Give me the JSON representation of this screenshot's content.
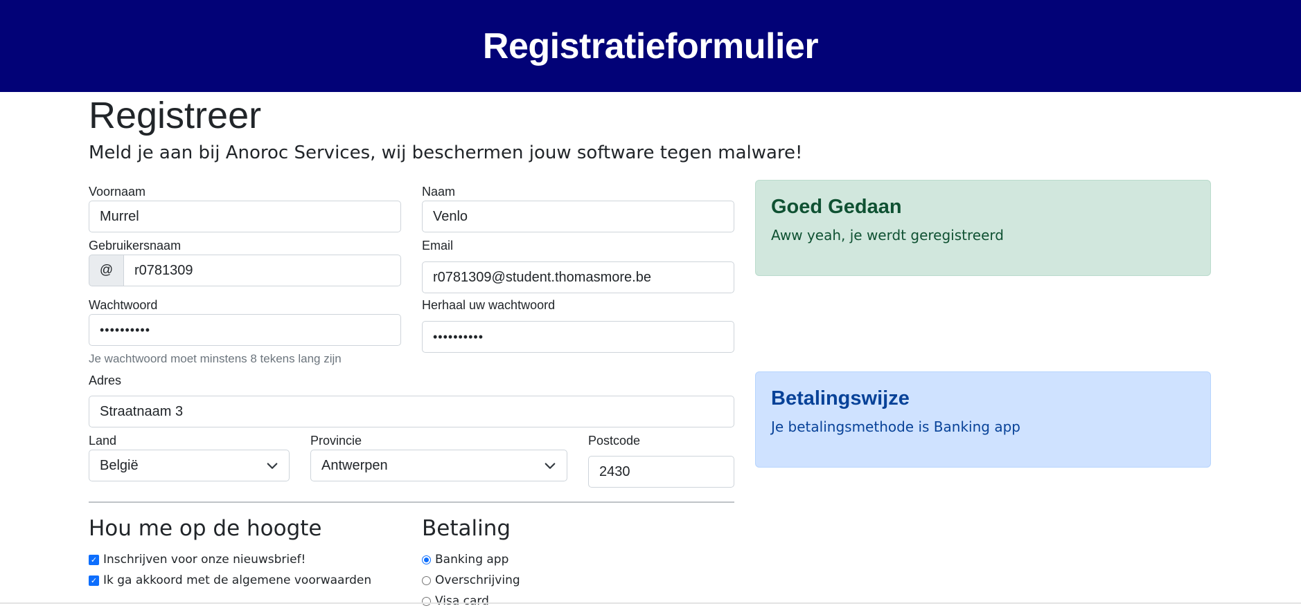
{
  "header": {
    "title": "Registratieformulier"
  },
  "page": {
    "title": "Registreer",
    "lead": "Meld je aan bij Anoroc Services, wij beschermen jouw software tegen malware!"
  },
  "form": {
    "voornaam": {
      "label": "Voornaam",
      "value": "Murrel"
    },
    "naam": {
      "label": "Naam",
      "value": "Venlo"
    },
    "gebruikersnaam": {
      "label": "Gebruikersnaam",
      "prefix": "@",
      "value": "r0781309"
    },
    "email": {
      "label": "Email",
      "value": "r0781309@student.thomasmore.be"
    },
    "wachtwoord": {
      "label": "Wachtwoord",
      "value": "••••••••••",
      "help": "Je wachtwoord moet minstens 8 tekens lang zijn"
    },
    "herhaal": {
      "label": "Herhaal uw wachtwoord",
      "value": "••••••••••"
    },
    "adres": {
      "label": "Adres",
      "value": "Straatnaam 3"
    },
    "land": {
      "label": "Land",
      "selected": "België"
    },
    "provincie": {
      "label": "Provincie",
      "selected": "Antwerpen"
    },
    "postcode": {
      "label": "Postcode",
      "value": "2430"
    }
  },
  "updates": {
    "title": "Hou me op de hoogte",
    "options": [
      {
        "label": "Inschrijven voor onze nieuwsbrief!",
        "checked": true
      },
      {
        "label": "Ik ga akkoord met de algemene voorwaarden",
        "checked": true
      }
    ]
  },
  "betaling": {
    "title": "Betaling",
    "options": [
      {
        "label": "Banking app",
        "selected": true
      },
      {
        "label": "Overschrijving",
        "selected": false
      },
      {
        "label": "Visa card",
        "selected": false
      }
    ]
  },
  "alerts": {
    "success": {
      "title": "Goed Gedaan",
      "text": "Aww yeah, je werdt geregistreerd"
    },
    "info": {
      "title": "Betalingswijze",
      "text": "Je betalingsmethode is Banking app"
    }
  },
  "colors": {
    "header_bg": "#020277",
    "primary": "#0d6efd",
    "success_bg": "#d1e7dd",
    "info_bg": "#cfe2ff"
  }
}
